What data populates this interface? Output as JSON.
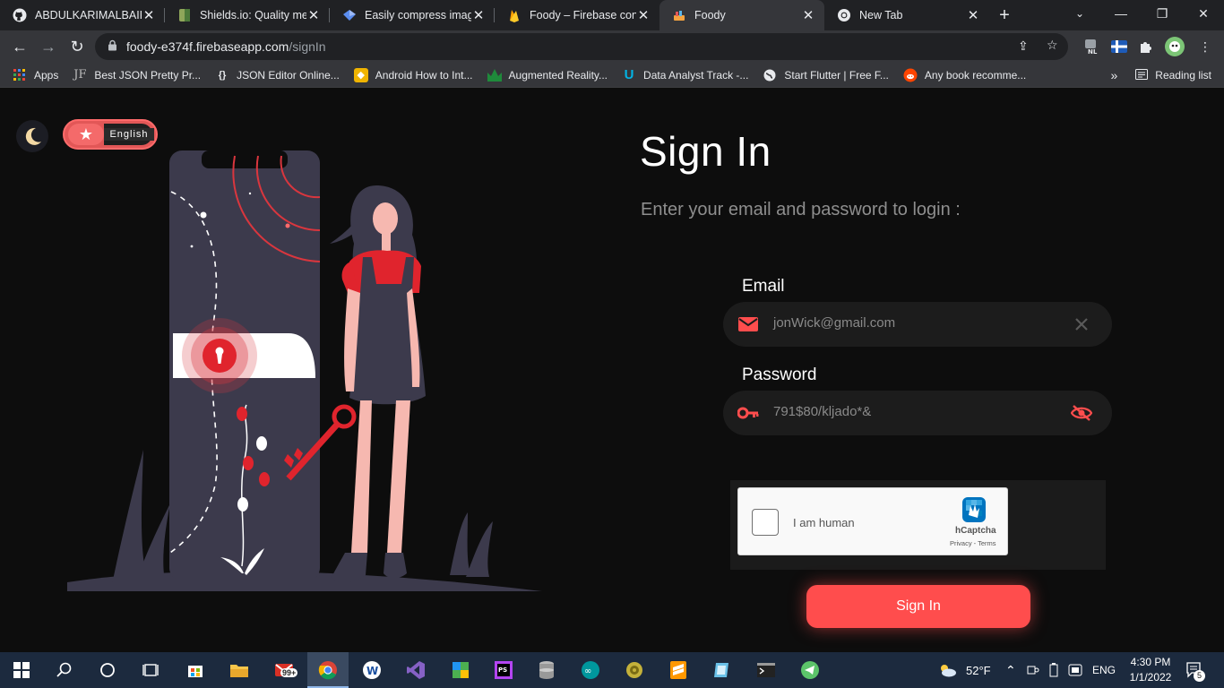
{
  "browser": {
    "tabs": [
      {
        "title": "ABDULKARIMALBAIK/",
        "icon": "github-icon"
      },
      {
        "title": "Shields.io: Quality met",
        "icon": "shields-icon"
      },
      {
        "title": "Easily compress image",
        "icon": "compress-icon"
      },
      {
        "title": "Foody – Firebase cons",
        "icon": "firebase-icon"
      },
      {
        "title": "Foody",
        "icon": "foody-icon"
      },
      {
        "title": "New Tab",
        "icon": "chrome-icon"
      }
    ],
    "url_host": "foody-e374f.firebaseapp.com",
    "url_path": "/signIn",
    "bookmarks": [
      {
        "label": "Apps",
        "icon": "apps-grid-icon"
      },
      {
        "label": "Best JSON Pretty Pr...",
        "icon": "jf-icon"
      },
      {
        "label": "JSON Editor Online...",
        "icon": "braces-icon"
      },
      {
        "label": "Android How to Int...",
        "icon": "android-icon"
      },
      {
        "label": "Augmented Reality...",
        "icon": "ar-icon"
      },
      {
        "label": "Data Analyst Track -...",
        "icon": "udacity-icon"
      },
      {
        "label": "Start Flutter | Free F...",
        "icon": "globe-icon"
      },
      {
        "label": "Any book recomme...",
        "icon": "reddit-icon"
      }
    ],
    "bookmarks_more": "»",
    "reading_list": "Reading list",
    "ext_badge": "NL"
  },
  "page": {
    "language_label": "English",
    "title": "Sign In",
    "subtitle": "Enter your email and password to login :",
    "email_label": "Email",
    "email_value": "jonWick@gmail.com",
    "password_label": "Password",
    "password_value": "791$80/kljado*&",
    "captcha_label": "I am human",
    "captcha_brand": "hCaptcha",
    "captcha_links": "Privacy - Terms",
    "signin_button": "Sign In"
  },
  "colors": {
    "accent": "#ff4d4d",
    "background": "#0d0d0d",
    "field_bg": "#1c1c1c"
  },
  "taskbar": {
    "weather_temp": "52°F",
    "language": "ENG",
    "time": "4:30 PM",
    "date": "1/1/2022",
    "notification_count": "5",
    "mail_badge": "99+"
  }
}
